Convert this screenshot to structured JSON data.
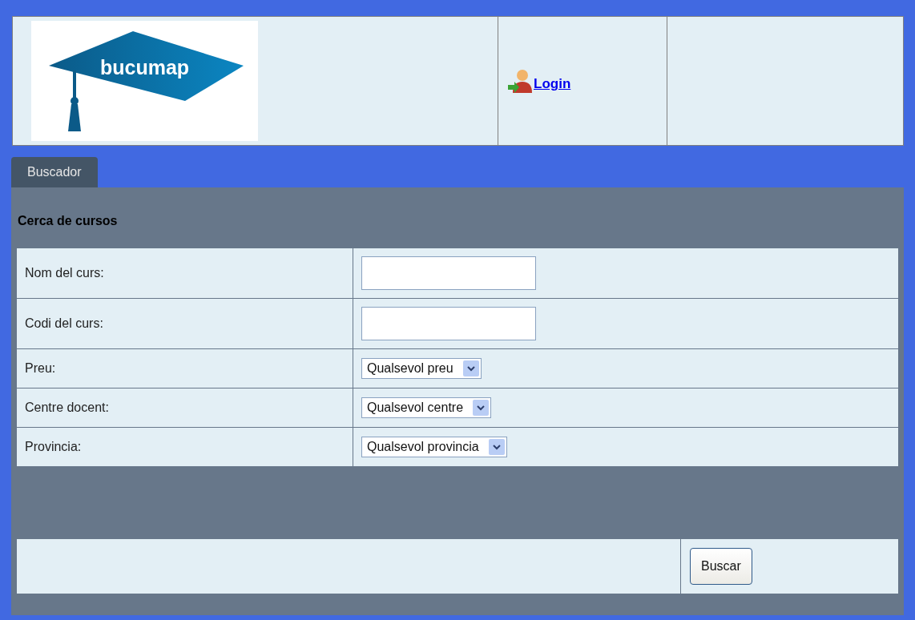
{
  "header": {
    "logo_text": "bucumap",
    "login": "Login"
  },
  "tabs": [
    {
      "label": "Buscador",
      "selected": true
    }
  ],
  "section_title": "Cerca de cursos",
  "fields": [
    {
      "kind": "text",
      "label": "Nom del curs:"
    },
    {
      "kind": "text",
      "label": "Codi del curs:"
    },
    {
      "kind": "select",
      "label": "Preu:",
      "value": "Qualsevol preu"
    },
    {
      "kind": "select",
      "label": "Centre docent:",
      "value": "Qualsevol centre"
    },
    {
      "kind": "select",
      "label": "Provincia:",
      "value": "Qualsevol provincia"
    }
  ],
  "submit": "Buscar"
}
